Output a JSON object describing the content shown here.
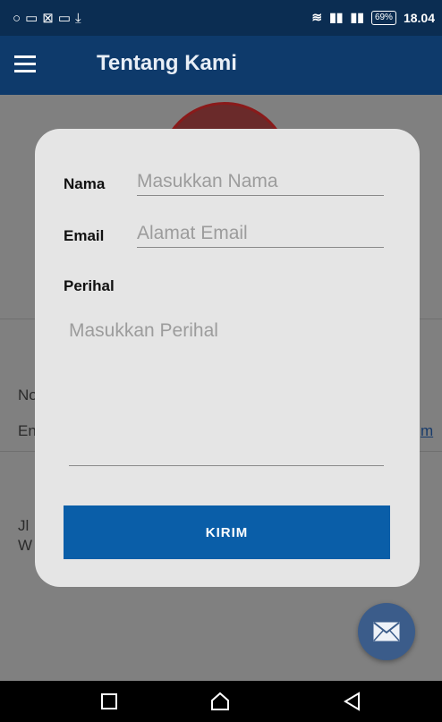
{
  "status_bar": {
    "left_icons": [
      "circle-icon",
      "chat-icon",
      "image-icon",
      "laptop-icon",
      "download-icon"
    ],
    "right_icons": [
      "wifi-icon",
      "signal-icon",
      "signal-icon"
    ],
    "battery": "69%",
    "time": "18.04"
  },
  "app_bar": {
    "title": "Tentang Kami",
    "menu_icon": "hamburger-menu-icon"
  },
  "background": {
    "row1": "No",
    "row2": "En",
    "row2_link_tail": "m",
    "row3": "Jl",
    "row4": "W"
  },
  "dialog": {
    "name_label": "Nama",
    "name_placeholder": "Masukkan Nama",
    "email_label": "Email",
    "email_placeholder": "Alamat Email",
    "subject_label": "Perihal",
    "subject_placeholder": "Masukkan Perihal",
    "submit_label": "KIRIM"
  },
  "fab": {
    "icon": "mail-icon"
  },
  "nav_bar": {
    "icons": [
      "recent-apps-icon",
      "home-icon",
      "back-icon"
    ]
  },
  "colors": {
    "app_bar": "#0e3a6b",
    "status_bar": "#0b2d52",
    "button": "#0a5ea8",
    "fab": "#3b5c8a"
  }
}
